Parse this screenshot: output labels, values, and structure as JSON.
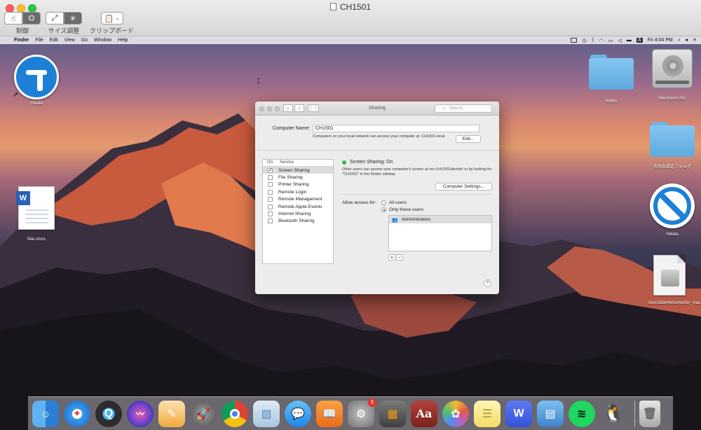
{
  "host": {
    "title": "CH1501",
    "toolbar": [
      {
        "label": "制御"
      },
      {
        "label": "サイズ調整"
      },
      {
        "label": "クリップボード"
      }
    ]
  },
  "menubar": {
    "apple": "",
    "items": [
      "Finder",
      "File",
      "Edit",
      "View",
      "Go",
      "Window",
      "Help"
    ],
    "clock": "Fri 4:04 PM",
    "input_source": "A"
  },
  "desktop": {
    "icons": {
      "hidata_top": "Hidata",
      "notes": "Notes",
      "hd": "Macintosh HD",
      "untitled_folder": "名称未設定フォルダ",
      "hidata_right": "Hidata",
      "docx": "Mac.docx",
      "dmg": "tunesfabm4vconverter_mac.dmg"
    }
  },
  "sharing": {
    "title": "Sharing",
    "search_placeholder": "Search",
    "computer_name_label": "Computer Name:",
    "computer_name_value": "CH1501",
    "computer_name_note": "Computers on your local network can access your computer at: CH1501.local",
    "edit_label": "Edit...",
    "col_on": "On",
    "col_service": "Service",
    "services": [
      {
        "name": "Screen Sharing",
        "on": true
      },
      {
        "name": "File Sharing",
        "on": false
      },
      {
        "name": "Printer Sharing",
        "on": false
      },
      {
        "name": "Remote Login",
        "on": false
      },
      {
        "name": "Remote Management",
        "on": false
      },
      {
        "name": "Remote Apple Events",
        "on": false
      },
      {
        "name": "Internet Sharing",
        "on": false
      },
      {
        "name": "Bluetooth Sharing",
        "on": false
      }
    ],
    "status": "Screen Sharing: On",
    "description": "Other users can access your computer's screen at vnc://ch1501demini/ or by looking for \"CH1501\" in the Finder sidebar.",
    "computer_settings_label": "Computer Settings...",
    "allow_access_label": "Allow access for:",
    "all_users_label": "All users",
    "only_these_users_label": "Only these users:",
    "users": [
      "Administrators"
    ],
    "add_label": "+",
    "remove_label": "−",
    "help_label": "?"
  },
  "dock": {
    "apps": [
      "finder",
      "safari",
      "quicktime",
      "siri",
      "pages",
      "launchpad",
      "chrome",
      "preview",
      "messages",
      "books",
      "system-preferences",
      "calculator",
      "dictionary",
      "photos",
      "notes",
      "wps",
      "keynote",
      "spotify",
      "qq",
      "trash"
    ],
    "system_preferences_badge": "1"
  },
  "colors": {
    "accent": "#1e7fd6",
    "status_green": "#2fb84b",
    "badge_red": "#e6342c"
  }
}
